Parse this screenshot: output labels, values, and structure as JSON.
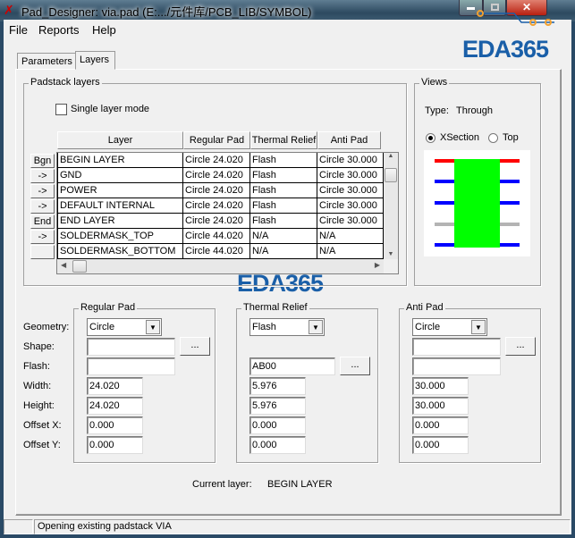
{
  "window": {
    "title": "Pad_Designer: via.pad (E:.../元件库/PCB_LIB/SYMBOL)"
  },
  "menu": [
    "File",
    "Reports",
    "Help"
  ],
  "tabs": [
    {
      "label": "Parameters",
      "active": false
    },
    {
      "label": "Layers",
      "active": true
    }
  ],
  "padstack": {
    "group_label": "Padstack layers",
    "single_layer_mode": {
      "label": "Single layer mode",
      "checked": false
    },
    "columns": [
      "Layer",
      "Regular Pad",
      "Thermal Relief",
      "Anti Pad"
    ],
    "rows": [
      {
        "button": "Bgn",
        "layer": "BEGIN LAYER",
        "regular": "Circle 24.020",
        "thermal": "Flash",
        "anti": "Circle 30.000"
      },
      {
        "button": "->",
        "layer": "GND",
        "regular": "Circle 24.020",
        "thermal": "Flash",
        "anti": "Circle 30.000"
      },
      {
        "button": "->",
        "layer": "POWER",
        "regular": "Circle 24.020",
        "thermal": "Flash",
        "anti": "Circle 30.000"
      },
      {
        "button": "->",
        "layer": "DEFAULT INTERNAL",
        "regular": "Circle 24.020",
        "thermal": "Flash",
        "anti": "Circle 30.000"
      },
      {
        "button": "End",
        "layer": "END LAYER",
        "regular": "Circle 24.020",
        "thermal": "Flash",
        "anti": "Circle 30.000"
      },
      {
        "button": "->",
        "layer": "SOLDERMASK_TOP",
        "regular": "Circle 44.020",
        "thermal": "N/A",
        "anti": "N/A"
      },
      {
        "button": "",
        "layer": "SOLDERMASK_BOTTOM",
        "regular": "Circle 44.020",
        "thermal": "N/A",
        "anti": "N/A"
      }
    ]
  },
  "views": {
    "group_label": "Views",
    "type_label": "Type:",
    "type_value": "Through",
    "radio_xsection": "XSection",
    "radio_top": "Top",
    "selected": "XSection",
    "colors": {
      "top_layer": "#ff0000",
      "inner_layer": "#0000ff",
      "plane_layer": "#b4b4b4",
      "drill": "#00ff00"
    }
  },
  "field_labels": {
    "geometry": "Geometry:",
    "shape": "Shape:",
    "flash": "Flash:",
    "width": "Width:",
    "height": "Height:",
    "offset_x": "Offset X:",
    "offset_y": "Offset Y:"
  },
  "regular_pad": {
    "label": "Regular Pad",
    "geometry": "Circle",
    "shape": "",
    "flash": "",
    "width": "24.020",
    "height": "24.020",
    "offset_x": "0.000",
    "offset_y": "0.000",
    "browse": "..."
  },
  "thermal_relief": {
    "label": "Thermal Relief",
    "geometry": "Flash",
    "flash": "AB00",
    "width": "5.976",
    "height": "5.976",
    "offset_x": "0.000",
    "offset_y": "0.000",
    "browse": "..."
  },
  "anti_pad": {
    "label": "Anti Pad",
    "geometry": "Circle",
    "shape": "",
    "flash": "",
    "width": "30.000",
    "height": "30.000",
    "offset_x": "0.000",
    "offset_y": "0.000",
    "browse": "..."
  },
  "current_layer": {
    "label": "Current layer:",
    "value": "BEGIN LAYER"
  },
  "status": {
    "message": "Opening existing padstack VIA"
  },
  "watermark": "EDA365"
}
